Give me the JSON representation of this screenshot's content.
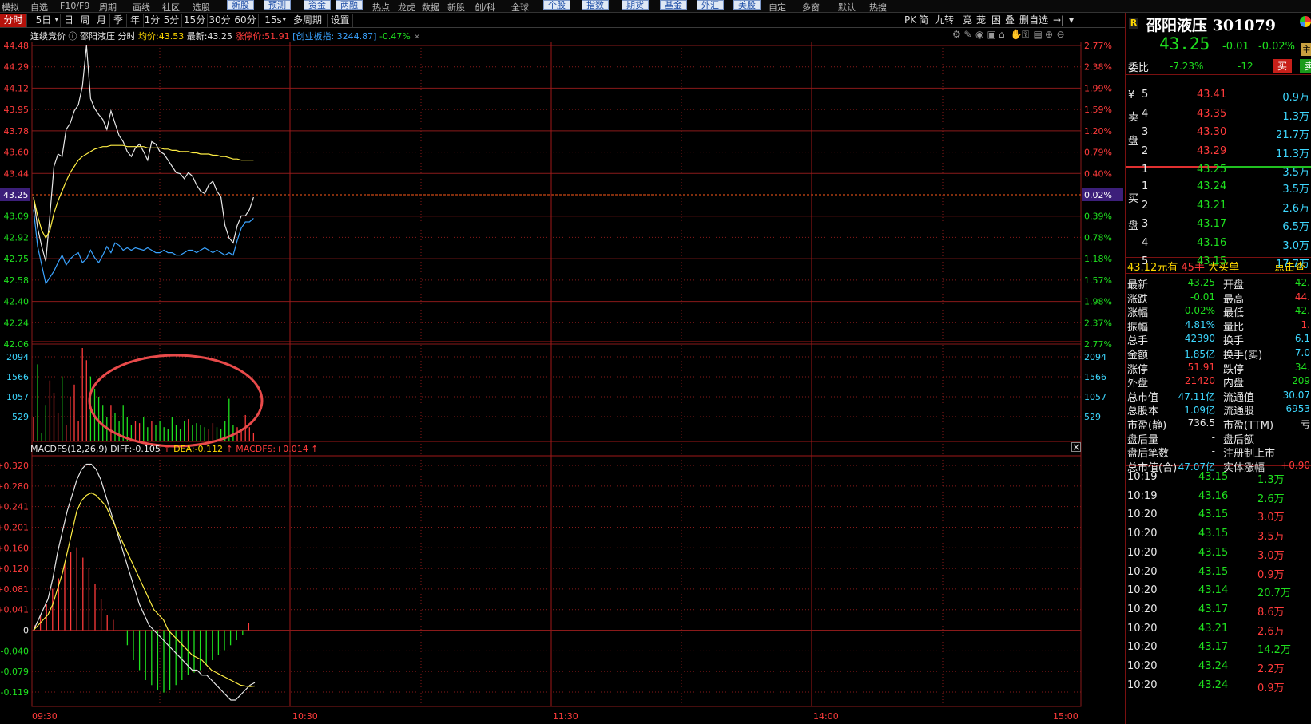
{
  "menu": {
    "items": [
      "模拟",
      "自选",
      "F10/F9",
      "周期",
      "画线",
      "社区",
      "选股",
      "新股",
      "预测",
      "资金",
      "两融",
      "热点",
      "龙虎",
      "数据",
      "新股",
      "创/科",
      "全球",
      "个股",
      "指数",
      "期货",
      "基金",
      "外汇",
      "美股",
      "自定",
      "多窗",
      "默认",
      "热搜"
    ]
  },
  "toolbar": {
    "tabs": [
      "分时",
      "5日",
      "日",
      "周",
      "月",
      "季",
      "年",
      "1分",
      "5分",
      "15分",
      "30分",
      "60分",
      "15s",
      "多周期",
      "设置"
    ],
    "right_buttons": [
      "PK",
      "简",
      "九转",
      "竞",
      "茏",
      "困",
      "叠",
      "删自选",
      "→|"
    ]
  },
  "chart_header": {
    "auction": "连续竞价",
    "name": "邵阳液压",
    "mode": "分时",
    "avg_label": "均价:",
    "avg_value": "43.53",
    "last_label": "最新:",
    "last_value": "43.25",
    "limit_label": "涨停价:",
    "limit_value": "51.91",
    "index_label": "[创业板指: 3244.87]",
    "index_change": "-0.47%",
    "close_x": "×"
  },
  "chart_icons": [
    "settings-icon",
    "pen-icon",
    "eye-icon",
    "camera-icon",
    "basket-icon",
    "hand-icon",
    "lock-icon",
    "table-icon",
    "zoom-in-icon",
    "zoom-out-icon"
  ],
  "price_axis": {
    "left": [
      "44.48",
      "44.29",
      "44.12",
      "43.95",
      "43.78",
      "43.60",
      "43.44",
      "43.25",
      "43.09",
      "42.92",
      "42.75",
      "42.58",
      "42.40",
      "42.24",
      "42.06"
    ],
    "right": [
      "2.77%",
      "2.38%",
      "1.99%",
      "1.59%",
      "1.20%",
      "0.79%",
      "0.40%",
      "0.02%",
      "0.39%",
      "0.78%",
      "1.18%",
      "1.57%",
      "1.98%",
      "2.37%",
      "2.77%"
    ],
    "right_colors": [
      "#ff3b3b",
      "#ff3b3b",
      "#ff3b3b",
      "#ff3b3b",
      "#ff3b3b",
      "#ff3b3b",
      "#ff3b3b",
      "#e8e8e8",
      "#1fe01f",
      "#1fe01f",
      "#1fe01f",
      "#1fe01f",
      "#1fe01f",
      "#1fe01f",
      "#1fe01f"
    ],
    "current": "43.25",
    "current_pct": "0.02%"
  },
  "volume_axis": {
    "left": [
      "2094",
      "1566",
      "1057",
      "529"
    ],
    "right": [
      "2094",
      "1566",
      "1057",
      "529"
    ]
  },
  "macd": {
    "header_name": "MACDFS(12,26,9)",
    "diff_label": "DIFF:",
    "diff_value": "-0.105",
    "dea_label": "DEA:",
    "dea_value": "-0.112",
    "macdfs_label": "MACDFS:",
    "macdfs_value": "+0.014",
    "axis": [
      "+0.320",
      "+0.280",
      "+0.241",
      "+0.201",
      "+0.160",
      "+0.120",
      "+0.081",
      "+0.041",
      "0",
      "-0.040",
      "-0.079",
      "-0.119"
    ],
    "close": "×"
  },
  "time_axis": [
    "09:30",
    "10:30",
    "11:30",
    "14:00",
    "15:00"
  ],
  "chart_data": {
    "type": "line",
    "title": "邵阳液压 分时",
    "xlabel": "",
    "ylabel": "",
    "ylim": [
      42.06,
      44.48
    ],
    "x_range": [
      "09:30",
      "15:00"
    ],
    "series": [
      {
        "name": "最新",
        "color": "#e8e8e8",
        "values": [
          43.25,
          43.0,
          42.85,
          42.73,
          43.1,
          43.5,
          43.6,
          43.58,
          43.8,
          43.85,
          43.95,
          44.0,
          44.15,
          44.48,
          44.05,
          43.97,
          43.92,
          43.88,
          43.8,
          43.95,
          43.85,
          43.75,
          43.7,
          43.62,
          43.58,
          43.65,
          43.68,
          43.62,
          43.55,
          43.7,
          43.68,
          43.62,
          43.6,
          43.55,
          43.5,
          43.45,
          43.44,
          43.4,
          43.45,
          43.42,
          43.35,
          43.3,
          43.28,
          43.35,
          43.38,
          43.3,
          43.25,
          43.02,
          42.92,
          42.88,
          43.02,
          43.1,
          43.1,
          43.15,
          43.25
        ]
      },
      {
        "name": "均价",
        "color": "#ffee44",
        "values": [
          43.25,
          43.1,
          42.98,
          42.92,
          42.98,
          43.12,
          43.22,
          43.3,
          43.38,
          43.45,
          43.5,
          43.55,
          43.58,
          43.6,
          43.62,
          43.64,
          43.65,
          43.66,
          43.66,
          43.67,
          43.67,
          43.67,
          43.67,
          43.66,
          43.66,
          43.66,
          43.66,
          43.66,
          43.65,
          43.65,
          43.65,
          43.65,
          43.64,
          43.64,
          43.63,
          43.63,
          43.62,
          43.62,
          43.62,
          43.61,
          43.61,
          43.6,
          43.6,
          43.6,
          43.59,
          43.59,
          43.58,
          43.58,
          43.57,
          43.56,
          43.56,
          43.55,
          43.55,
          43.55,
          43.55
        ]
      },
      {
        "name": "创业板指",
        "color": "#3aa3ff",
        "values": [
          43.15,
          42.85,
          42.7,
          42.55,
          42.6,
          42.65,
          42.72,
          42.78,
          42.7,
          42.75,
          42.78,
          42.8,
          42.72,
          42.75,
          42.82,
          42.76,
          42.72,
          42.78,
          42.85,
          42.8,
          42.88,
          42.86,
          42.82,
          42.84,
          42.82,
          42.84,
          42.83,
          42.82,
          42.84,
          42.82,
          42.8,
          42.8,
          42.82,
          42.8,
          42.8,
          42.78,
          42.78,
          42.8,
          42.82,
          42.82,
          42.8,
          42.82,
          42.84,
          42.82,
          42.8,
          42.82,
          42.8,
          42.78,
          42.8,
          42.78,
          42.9,
          43.0,
          43.05,
          43.05,
          43.08
        ]
      }
    ],
    "volume": {
      "ylim": [
        0,
        2300
      ],
      "values": [
        600,
        1900,
        200,
        900,
        1500,
        1200,
        700,
        1600,
        400,
        1100,
        1400,
        500,
        2300,
        2000,
        1600,
        1300,
        1100,
        900,
        600,
        900,
        700,
        500,
        900,
        600,
        400,
        500,
        450,
        600,
        350,
        500,
        400,
        500,
        350,
        300,
        600,
        400,
        300,
        500,
        550,
        400,
        450,
        400,
        350,
        300,
        450,
        350,
        300,
        500,
        1050,
        400,
        350,
        300,
        650,
        350,
        200
      ]
    },
    "macd": {
      "ylim": [
        -0.14,
        0.33
      ],
      "diff": [
        0.0,
        0.02,
        0.04,
        0.06,
        0.1,
        0.15,
        0.19,
        0.23,
        0.26,
        0.29,
        0.31,
        0.32,
        0.32,
        0.31,
        0.29,
        0.26,
        0.23,
        0.2,
        0.17,
        0.14,
        0.11,
        0.08,
        0.05,
        0.03,
        0.01,
        0.0,
        -0.01,
        -0.02,
        -0.03,
        -0.04,
        -0.05,
        -0.06,
        -0.07,
        -0.08,
        -0.08,
        -0.09,
        -0.09,
        -0.1,
        -0.11,
        -0.12,
        -0.13,
        -0.14,
        -0.14,
        -0.13,
        -0.12,
        -0.11,
        -0.105
      ],
      "dea": [
        0.0,
        0.01,
        0.02,
        0.03,
        0.05,
        0.08,
        0.11,
        0.15,
        0.19,
        0.23,
        0.25,
        0.26,
        0.265,
        0.26,
        0.25,
        0.24,
        0.22,
        0.2,
        0.18,
        0.16,
        0.14,
        0.12,
        0.1,
        0.08,
        0.06,
        0.04,
        0.03,
        0.02,
        0.0,
        -0.01,
        -0.02,
        -0.03,
        -0.04,
        -0.05,
        -0.055,
        -0.06,
        -0.07,
        -0.08,
        -0.085,
        -0.09,
        -0.095,
        -0.1,
        -0.105,
        -0.11,
        -0.112,
        -0.113,
        -0.112
      ],
      "bars": [
        0.01,
        0.03,
        0.05,
        0.08,
        0.1,
        0.13,
        0.15,
        0.16,
        0.14,
        0.12,
        0.09,
        0.06,
        0.03,
        0.02,
        -0.03,
        -0.06,
        -0.08,
        -0.1,
        -0.11,
        -0.12,
        -0.125,
        -0.12,
        -0.11,
        -0.1,
        -0.09,
        -0.085,
        -0.08,
        -0.07,
        -0.06,
        -0.05,
        -0.04,
        -0.03,
        -0.02,
        -0.01,
        0.014
      ]
    }
  },
  "panel": {
    "r_badge": "R",
    "title": "邵阳液压 301079",
    "price": "43.25",
    "change": "-0.01",
    "change_pct": "-0.02%",
    "badge": "主",
    "webi_label": "委比",
    "webi_value": "-7.23%",
    "webi_diff": "-12",
    "buy_btn": "买",
    "sell_btn": "卖",
    "sell_side_label": [
      "卖",
      "盘"
    ],
    "buy_side_label": [
      "买",
      "盘"
    ],
    "sell_levels": [
      {
        "lvl": "5",
        "price": "43.41",
        "vol": "0.9万"
      },
      {
        "lvl": "4",
        "price": "43.35",
        "vol": "1.3万"
      },
      {
        "lvl": "3",
        "price": "43.30",
        "vol": "21.7万"
      },
      {
        "lvl": "2",
        "price": "43.29",
        "vol": "11.3万"
      },
      {
        "lvl": "1",
        "price": "43.25",
        "vol": "3.5万"
      }
    ],
    "buy_levels": [
      {
        "lvl": "1",
        "price": "43.24",
        "vol": "3.5万"
      },
      {
        "lvl": "2",
        "price": "43.21",
        "vol": "2.6万"
      },
      {
        "lvl": "3",
        "price": "43.17",
        "vol": "6.5万"
      },
      {
        "lvl": "4",
        "price": "43.16",
        "vol": "3.0万"
      },
      {
        "lvl": "5",
        "price": "43.15",
        "vol": "17.7万"
      }
    ],
    "big_order": {
      "price": "43.12",
      "unit1": "元有",
      "count": "45手",
      "label": "大买单",
      "link": "点击查"
    },
    "stats_left": [
      {
        "k": "最新",
        "v": "43.25",
        "c": "#1fe01f"
      },
      {
        "k": "涨跌",
        "v": "-0.01",
        "c": "#1fe01f"
      },
      {
        "k": "涨幅",
        "v": "-0.02%",
        "c": "#1fe01f"
      },
      {
        "k": "振幅",
        "v": "4.81%",
        "c": "#3ed8ff"
      },
      {
        "k": "总手",
        "v": "42390",
        "c": "#3ed8ff"
      },
      {
        "k": "金额",
        "v": "1.85亿",
        "c": "#3ed8ff"
      },
      {
        "k": "涨停",
        "v": "51.91",
        "c": "#ff3b3b"
      },
      {
        "k": "外盘",
        "v": "21420",
        "c": "#ff3b3b"
      },
      {
        "k": "总市值",
        "v": "47.11亿",
        "c": "#3ed8ff"
      },
      {
        "k": "总股本",
        "v": "1.09亿",
        "c": "#3ed8ff"
      },
      {
        "k": "市盈(静)",
        "v": "736.5",
        "c": "#e8e8e8"
      },
      {
        "k": "盘后量",
        "v": "-",
        "c": "#e8e8e8"
      },
      {
        "k": "盘后笔数",
        "v": "-",
        "c": "#e8e8e8"
      },
      {
        "k": "总市值(合)",
        "v": "47.07亿",
        "c": "#3ed8ff"
      }
    ],
    "stats_right": [
      {
        "k": "开盘",
        "v": "42.",
        "c": "#1fe01f"
      },
      {
        "k": "最高",
        "v": "44.",
        "c": "#ff3b3b"
      },
      {
        "k": "最低",
        "v": "42.",
        "c": "#1fe01f"
      },
      {
        "k": "量比",
        "v": "1.",
        "c": "#ff3b3b"
      },
      {
        "k": "换手",
        "v": "6.1",
        "c": "#3ed8ff"
      },
      {
        "k": "换手(实)",
        "v": "7.0",
        "c": "#3ed8ff"
      },
      {
        "k": "跌停",
        "v": "34.",
        "c": "#1fe01f"
      },
      {
        "k": "内盘",
        "v": "209",
        "c": "#1fe01f"
      },
      {
        "k": "流通值",
        "v": "30.07",
        "c": "#3ed8ff"
      },
      {
        "k": "流通股",
        "v": "6953",
        "c": "#3ed8ff"
      },
      {
        "k": "市盈(TTM)",
        "v": "亏",
        "c": "#e8e8e8"
      },
      {
        "k": "盘后额",
        "v": "",
        "c": "#e8e8e8"
      },
      {
        "k": "注册制上市",
        "v": "",
        "c": "#e8e8e8"
      },
      {
        "k": "实体涨幅",
        "v": "+0.90",
        "c": "#ff3b3b"
      }
    ],
    "trades": [
      {
        "t": "10:19",
        "p": "43.15",
        "v": "1.3万",
        "vc": "#1fe01f"
      },
      {
        "t": "10:19",
        "p": "43.16",
        "v": "2.6万",
        "vc": "#1fe01f"
      },
      {
        "t": "10:20",
        "p": "43.15",
        "v": "3.0万",
        "vc": "#ff3b3b"
      },
      {
        "t": "10:20",
        "p": "43.15",
        "v": "3.5万",
        "vc": "#ff3b3b"
      },
      {
        "t": "10:20",
        "p": "43.15",
        "v": "3.0万",
        "vc": "#ff3b3b"
      },
      {
        "t": "10:20",
        "p": "43.15",
        "v": "0.9万",
        "vc": "#ff3b3b"
      },
      {
        "t": "10:20",
        "p": "43.14",
        "v": "20.7万",
        "vc": "#1fe01f"
      },
      {
        "t": "10:20",
        "p": "43.17",
        "v": "8.6万",
        "vc": "#ff3b3b"
      },
      {
        "t": "10:20",
        "p": "43.21",
        "v": "2.6万",
        "vc": "#ff3b3b"
      },
      {
        "t": "10:20",
        "p": "43.17",
        "v": "14.2万",
        "vc": "#1fe01f"
      },
      {
        "t": "10:20",
        "p": "43.24",
        "v": "2.2万",
        "vc": "#ff3b3b"
      },
      {
        "t": "10:20",
        "p": "43.24",
        "v": "0.9万",
        "vc": "#ff3b3b"
      }
    ]
  }
}
